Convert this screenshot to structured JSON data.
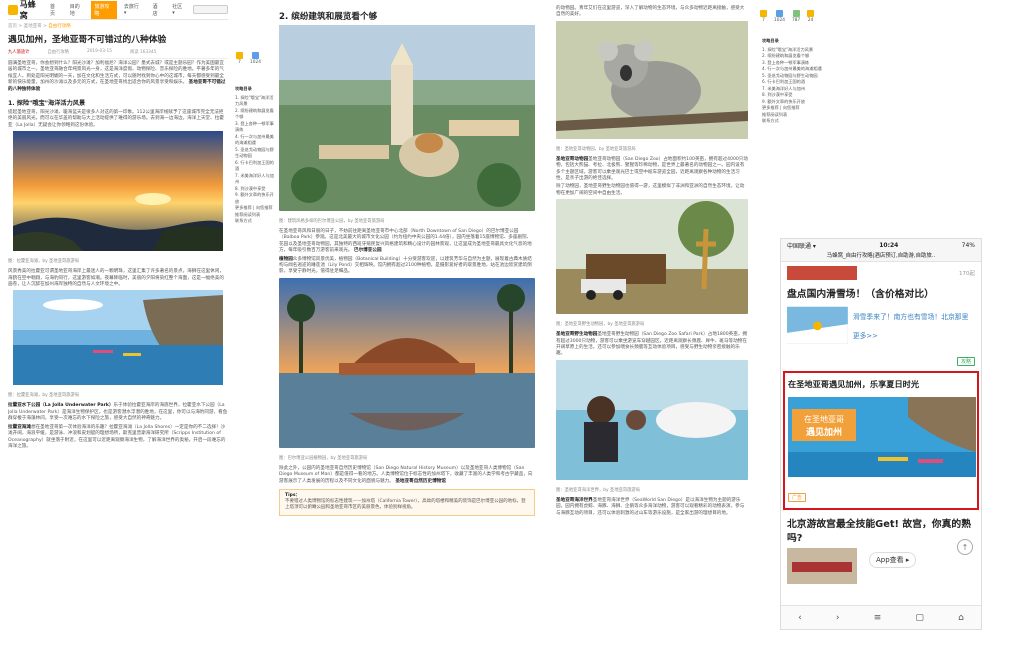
{
  "site": {
    "logo_text": "马蜂窝",
    "nav": [
      "首页",
      "目的地",
      "旅游攻略",
      "去旅行 ▾",
      "酒店",
      "社区 ▾"
    ],
    "active_nav": "旅游攻略"
  },
  "crumb": {
    "a": "首页",
    "sep": " > ",
    "b": "圣地亚哥",
    "c": "自由行攻略"
  },
  "article": {
    "title": "遇见加州，圣地亚哥不可错过的八种体验",
    "author": "九人旅途计",
    "source": "自由行攻略",
    "date": "2019-03-15",
    "views": "阅读 163345"
  },
  "stats": {
    "like": "7",
    "fav": "1024",
    "reply": "16",
    "share": "24",
    "count2": "787"
  },
  "toc": {
    "heading": "攻略目录",
    "items": [
      "1. 探险\"哦宝\"海洋活力风景",
      "2. 缤纷建筑和展览看个够",
      "3. 登上各种一顿军事演练",
      "4. 行一次与加州最美的海滩相遇",
      "5. 圣迭戈动物园与野生动物园",
      "6. 行卡巴利加王国的酒",
      "7. 米美海洋好人与加州",
      "8. 到沙漠中享受",
      "9. 额外文章的快乐开放",
      "更多推荐 | 向您推荐",
      "推荐阅读列表",
      "联系方式"
    ]
  },
  "col1": {
    "p1": "圆满圣地亚哥，你会想到什么？阳光沙滩？加利福尼？海洋公园？墨式去城？或是主题乐园？作为美国最宜居的城市之一，圣地亚哥融合年纯景风光一身，这是海洋度假、动物探险、音乐探险的胜地。平著多年的气候宜人，到处是阳光明媚的一天，加在文化和生活方式，可以随时找到你心中的这城市，每天都感受到最全新的快乐能量，加州的沙滩以及多元的方式，在圣地亚哥找出适合你的风景享受和娱乐。",
    "bold1": "圣地亚哥不可错过的八种独特体验",
    "h1": "1. 探险\"哦宝\"海洋活力风景",
    "p2": "提起圣地亚哥，阳光沙滩、暖海蓝天是很多人对这的第一印象。112公里海岸线赋予了这座城市完全无法拒绝的美丽风光，而可以在华盖的帮助与大上活动提供了难得的游乐场。去到海一边海边，海洋上天堂、拉霍亚（La Jolla）无疑会让你领略到这份体验。",
    "cap1": "图：拉霍亚海滩，by 圣地亚哥旅游局",
    "p3": "风景秀美的拉霍亚可谓圣地亚哥海岸上最迷人的一颗明珠，这里汇集了许多著名的景点，海狮在这里休闲，海鸥在空中翱翔，与海豹同行，这里游客如潮。夜幕降临时，美丽的夕阳将染红整个海面，这是一幅绝美的画卷，让人沉醉在加州海岸独特的自然与人文环境之中。",
    "cap2": "图：拉霍亚海滩，by 圣地亚哥旅游局",
    "p4": "乐于体验拉霍亚海岸的海底世界，拉霍亚水下公园（La Jolla Underwater Park）是海洋生物保护区，也是游客潜水浮潜的胜地，在这里，你可以与海豹同游，看鱼群穿梭于海藻林间，享受一次难忘的水下探险之旅，感受大自然的神奇魅力。",
    "bold2": "拉霍亚水下公园（La Jolla Underwater Park）",
    "p5": "想在圣地亚哥第一次体验海洋的乐趣？拉霍亚海滩（La Jolla Shores）一定是你的不二选择！沙滩开阔，海浪平缓，是游泳、冲浪和皮划艇的理想场所，斯克里普斯海洋研究所（Scripps Institution of Oceanography）就坐落于附近，在这里可以近距离观察海洋生物，了解海洋世界的奥秘，开启一段难忘的海洋之旅。",
    "bold3": "拉霍亚海滩"
  },
  "col2": {
    "h2": "2. 缤纷建筑和展览看个够",
    "cap1": "图：建筑风格多样的巴尔博亚公园，by 圣地亚哥旅游局",
    "p1": "在圣地亚哥风和日丽的日子，不妨前往距离圣地亚哥市中心北部（North Downtown of San Diego）的巴尔博亚公园（Balboa Park）参观。这是北美最大的城市文化公园（约为纽约中央公园的1.44倍），园内坐落着15座博物馆、多座剧院、花园以及圣地亚哥动物园，其独特的西班牙殖民复兴风格建筑和精心设计的园林景观，让这里成为圣地亚哥最具文化气息的地方，每年吸引数百万游客前来观光。",
    "bold1": "巴尔博亚公园",
    "p2": "众多博物馆风景优美，植物园（Botanical Building）十分受游客欢迎，以建筑芳华与自然为主题，展现着古典木质结构与闻名遐迩的睡莲池（Lily Pond）交相辉映。馆内拥有超过2100种植物，是摄影爱好者的取景胜地，站在池边欣赏建筑倒影，享受宁静时光，值得驻足细品。",
    "bold2": "植物园",
    "cap2": "图：巴尔博亚公园植物园，by 圣地亚哥旅游局",
    "p3": "除此之外，公园内的圣地亚哥自然历史博物馆（San Diego Natural History Museum）以及圣地亚哥人类博物馆（San Diego Museum of Man）都是值得一看的地方。人类博物馆位于标志性的加州塔下，收藏了丰富的人类学和考古学藏品，向游客展示了人类发展的历程以及不同文化的面貌与魅力。",
    "bold3": "圣地亚哥自然历史博物馆",
    "tip_label": "Tips：",
    "tip": "不要错过人类博物馆的标志性建筑——加州塔（California Tower），高耸的塔楼和精美的装饰是巴尔博亚公园的地标，登上塔顶可以俯瞰公园和圣地亚哥市区的美丽景色，体验别样视角。"
  },
  "col3": {
    "p0": "的动物园。青年艾们在这里游览，深入了解动物的生态环境，与众多动物近距离接触，感受大自然的美好。",
    "cap1": "图：圣地亚哥动物园，by 圣地亚哥旅游局",
    "p1": "圣地亚哥动物园（San Diego Zoo）占地面积约100英亩，拥有超过4000只动物，包括大熊猫、考拉、北极熊、猩猩等珍稀动物，是世界上最著名的动物园之一。园内设有多个主题区域，游客可以乘坐观光巴士或空中缆车游览全园，近距离观察各种动物的生活习性，是亲子出游的绝佳选择。",
    "bold1": "圣地亚哥动物园",
    "p2": "除了动物园，圣地亚哥野生动物园也值得一游，这里模拟了非洲和亚洲的自然生态环境，让动物在更加广阔的空间中自由生活。",
    "cap2": "图：圣地亚哥野生动物园，by 圣地亚哥旅游局",
    "p3": "圣地亚哥野生动物园（San Diego Zoo Safari Park）占地1800英亩，拥有超过3000只动物，游客可以乘坐游览车穿越园区，近距离观察长颈鹿、犀牛、斑马等动物在开阔草原上的生活，还可以参加喂食长颈鹿等互动体验项目，感受与野生动物亲密接触的乐趣。",
    "bold2": "圣地亚哥野生动物园",
    "cap3": "图：圣地亚哥海洋世界，by 圣地亚哥旅游局",
    "p4": "圣地亚哥海洋世界（SeaWorld San Diego）是以海洋生物为主题的游乐园，园内拥有虎鲸、海豚、海狮、企鹅等众多海洋动物，游客可以观看精彩的动物表演，参与与海豚互动的项目，还可以体验刺激的过山车等游乐设施，是全家出游的理想目的地。",
    "bold3": "圣地亚哥海洋世界"
  },
  "phone": {
    "carrier": "中国联通 ▾",
    "time": "10:24",
    "battery": "74%",
    "url": "马蜂窝_自由行攻略|酒店预订,自助游,自助旅..",
    "price": "170起",
    "tag1": "攻略",
    "title1": "盘点国内滑雪场！（含价格对比）",
    "sub1": "滑雪季来了！南方也有雪场！北京那里更多>>",
    "tag2": "攻略",
    "ad_title": "在圣地亚哥遇见加州，乐享夏日时光",
    "ad_banner_l1": "在圣地亚哥",
    "ad_banner_l2": "遇见加州",
    "ad_label": "广告",
    "title2": "北京游故宫最全技能Get! 故宫，你真的熟吗?",
    "appbtn": "App查看 ▸"
  }
}
